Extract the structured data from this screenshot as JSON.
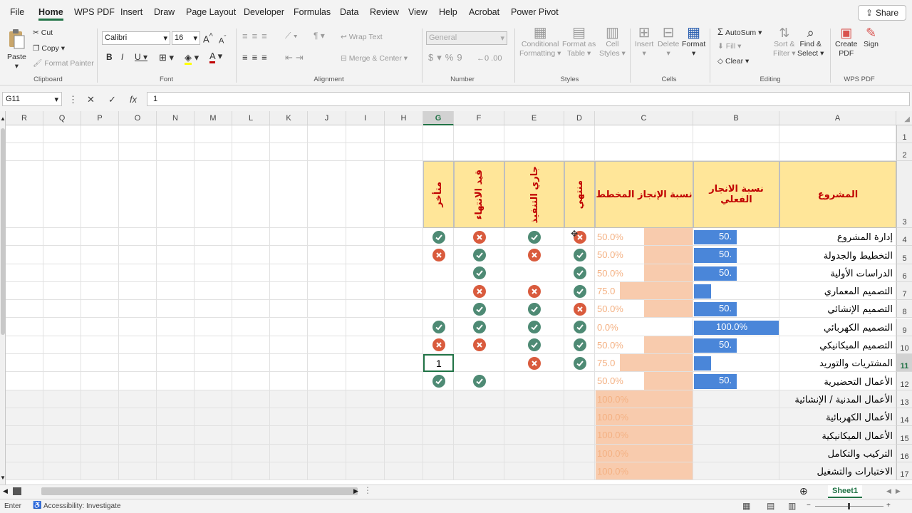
{
  "menu": [
    "File",
    "Home",
    "WPS PDF",
    "Insert",
    "Draw",
    "Page Layout",
    "Developer",
    "Formulas",
    "Data",
    "Review",
    "View",
    "Help",
    "Acrobat",
    "Power Pivot"
  ],
  "share_label": "Share",
  "ribbon": {
    "clipboard": {
      "label": "Clipboard",
      "paste": "Paste",
      "cut": "Cut",
      "copy": "Copy",
      "format_painter": "Format Painter"
    },
    "font": {
      "label": "Font",
      "name": "Calibri",
      "size": "16"
    },
    "alignment": {
      "label": "Alignment",
      "wrap": "Wrap Text",
      "merge": "Merge & Center"
    },
    "number": {
      "label": "Number",
      "format": "General"
    },
    "styles": {
      "label": "Styles",
      "cond1": "Conditional",
      "cond2": "Formatting",
      "fmt1": "Format as",
      "fmt2": "Table",
      "cell1": "Cell",
      "cell2": "Styles"
    },
    "cells": {
      "label": "Cells",
      "insert": "Insert",
      "delete": "Delete",
      "format": "Format"
    },
    "editing": {
      "label": "Editing",
      "autosum": "AutoSum",
      "fill": "Fill",
      "clear": "Clear",
      "sort1": "Sort &",
      "sort2": "Filter",
      "find1": "Find &",
      "find2": "Select"
    },
    "wps": {
      "label": "WPS PDF",
      "create1": "Create",
      "create2": "PDF",
      "sign": "Sign"
    }
  },
  "formula": {
    "namebox": "G11",
    "value": "1"
  },
  "columns": [
    "R",
    "Q",
    "P",
    "O",
    "N",
    "M",
    "L",
    "K",
    "J",
    "I",
    "H",
    "G",
    "F",
    "E",
    "D",
    "C",
    "B",
    "A"
  ],
  "selected_col": "G",
  "selected_row": "11",
  "rows_nums": [
    "1",
    "2",
    "3",
    "4",
    "5",
    "6",
    "7",
    "8",
    "9",
    "10",
    "11",
    "12",
    "13",
    "14",
    "15",
    "16",
    "17"
  ],
  "headers": {
    "project": "المشروع",
    "actual": "نسبة الانجار الفعلي",
    "planned": "نسبة الإنجاز المخطط",
    "done": "منتهي",
    "inprogress": "جاري التنفيذ",
    "finishing": "قيد الانتهاء",
    "late": "متأخر"
  },
  "projects": [
    {
      "name": "إدارة المشروع",
      "actual": "50.",
      "actual_frac": 0.5,
      "planned": "50.0%",
      "planned_frac": 0.5,
      "d": "x",
      "e": "ok",
      "f": "x",
      "g": "ok"
    },
    {
      "name": "التخطيط والجدولة",
      "actual": "50.",
      "actual_frac": 0.5,
      "planned": "50.0%",
      "planned_frac": 0.5,
      "d": "ok",
      "e": "x",
      "f": "ok",
      "g": "x"
    },
    {
      "name": "الدراسات الأولية",
      "actual": "50.",
      "actual_frac": 0.5,
      "planned": "50.0%",
      "planned_frac": 0.5,
      "d": "ok",
      "e": "",
      "f": "ok",
      "g": ""
    },
    {
      "name": "التصميم المعماري",
      "actual": "",
      "actual_frac": 0.2,
      "planned": "75.0",
      "planned_frac": 0.75,
      "d": "ok",
      "e": "x",
      "f": "x",
      "g": ""
    },
    {
      "name": "التصميم الإنشائي",
      "actual": "50.",
      "actual_frac": 0.5,
      "planned": "50.0%",
      "planned_frac": 0.5,
      "d": "x",
      "e": "ok",
      "f": "ok",
      "g": ""
    },
    {
      "name": "التصميم الكهربائي",
      "actual": "100.0%",
      "actual_frac": 1.0,
      "planned": "0.0%",
      "planned_frac": 0,
      "d": "ok",
      "e": "ok",
      "f": "ok",
      "g": "ok"
    },
    {
      "name": "التصميم الميكانيكي",
      "actual": "50.",
      "actual_frac": 0.5,
      "planned": "50.0%",
      "planned_frac": 0.5,
      "d": "ok",
      "e": "ok",
      "f": "x",
      "g": "x"
    },
    {
      "name": "المشتريات والتوريد",
      "actual": "",
      "actual_frac": 0.2,
      "planned": "75.0",
      "planned_frac": 0.75,
      "d": "ok",
      "e": "x",
      "f": "",
      "g": "1"
    },
    {
      "name": "الأعمال التحضيرية",
      "actual": "50.",
      "actual_frac": 0.5,
      "planned": "50.0%",
      "planned_frac": 0.5,
      "d": "",
      "e": "",
      "f": "ok",
      "g": "ok"
    },
    {
      "name": "الأعمال المدنية / الإنشائية",
      "actual": "",
      "actual_frac": 0,
      "planned": "100.0%",
      "planned_frac": 1.0,
      "d": "",
      "e": "",
      "f": "",
      "g": ""
    },
    {
      "name": "الأعمال الكهربائية",
      "actual": "",
      "actual_frac": 0,
      "planned": "100.0%",
      "planned_frac": 1.0,
      "d": "",
      "e": "",
      "f": "",
      "g": ""
    },
    {
      "name": "الأعمال الميكانيكية",
      "actual": "",
      "actual_frac": 0,
      "planned": "100.0%",
      "planned_frac": 1.0,
      "d": "",
      "e": "",
      "f": "",
      "g": ""
    },
    {
      "name": "التركيب والتكامل",
      "actual": "",
      "actual_frac": 0,
      "planned": "100.0%",
      "planned_frac": 1.0,
      "d": "",
      "e": "",
      "f": "",
      "g": ""
    },
    {
      "name": "الاختبارات والتشغيل",
      "actual": "",
      "actual_frac": 0,
      "planned": "100.0%",
      "planned_frac": 1.0,
      "d": "",
      "e": "",
      "f": "",
      "g": ""
    }
  ],
  "sheet_tab": "Sheet1",
  "status": {
    "mode": "Enter",
    "accessibility": "Accessibility: Investigate"
  },
  "colors": {
    "accent": "#217346",
    "header_fill": "#ffe699",
    "header_text": "#c00000",
    "actual_bar": "#4a86d9",
    "planned_bar": "#f8cbad",
    "check": "#4e8a74",
    "cross": "#d95b3d"
  }
}
